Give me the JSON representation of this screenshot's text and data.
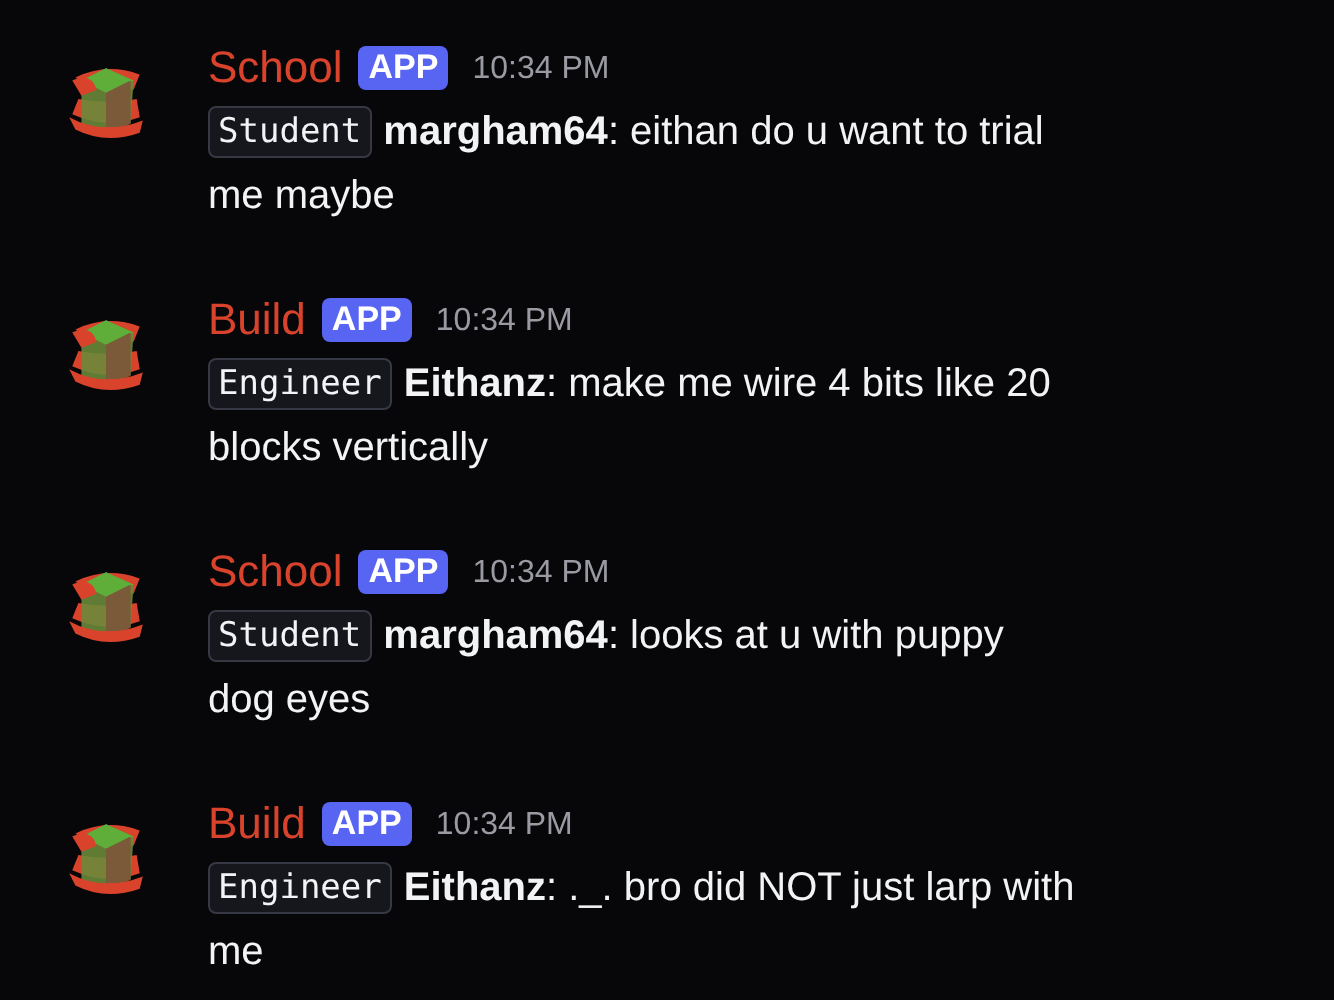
{
  "messages": [
    {
      "bot": "School",
      "badge": "APP",
      "time": "10:34 PM",
      "role": "Student",
      "line_1": "**margham64**:  eithan do u want to trial",
      "line_2": "me maybe"
    },
    {
      "bot": "Build",
      "badge": "APP",
      "time": "10:34 PM",
      "role": "Engineer",
      "line_1": "**Eithanz**:  make me wire 4 bits like 20",
      "line_2": "blocks vertically"
    },
    {
      "bot": "School",
      "badge": "APP",
      "time": "10:34 PM",
      "role": "Student",
      "line_1": "**margham64**:  looks at u with puppy",
      "line_2": "dog eyes"
    },
    {
      "bot": "Build",
      "badge": "APP",
      "time": "10:34 PM",
      "role": "Engineer",
      "line_1": "**Eithanz**:  ._. bro did NOT just larp with",
      "line_2": "me"
    }
  ]
}
